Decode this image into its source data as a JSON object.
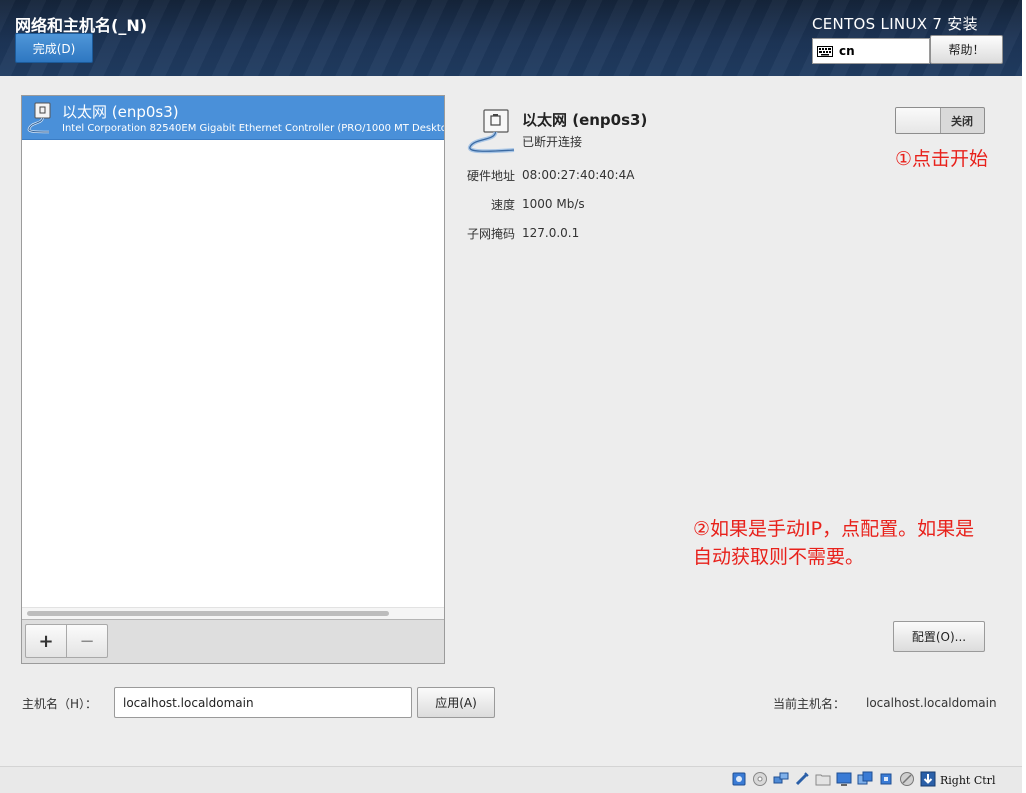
{
  "header": {
    "page_title": "网络和主机名(_N)",
    "done_label": "完成(D)",
    "product_title": "CENTOS LINUX 7 安装",
    "keyboard_layout": "cn",
    "help_label": "帮助！"
  },
  "network_list": {
    "items": [
      {
        "name": "以太网 (enp0s3)",
        "description": "Intel Corporation 82540EM Gigabit Ethernet Controller (PRO/1000 MT Deskto",
        "selected": true
      }
    ],
    "add_label": "+",
    "remove_label": "−"
  },
  "details": {
    "name": "以太网 (enp0s3)",
    "status": "已断开连接",
    "toggle_label": "关闭",
    "toggle_on": false,
    "properties": [
      {
        "label": "硬件地址",
        "value": "08:00:27:40:40:4A"
      },
      {
        "label": "速度",
        "value": "1000 Mb/s"
      },
      {
        "label": "子网掩码",
        "value": "127.0.0.1"
      }
    ],
    "configure_label": "配置(O)..."
  },
  "annotations": {
    "note1": "①点击开始",
    "note2_line1": "②如果是手动IP，点配置。如果是",
    "note2_line2": "自动获取则不需要。"
  },
  "hostname": {
    "label": "主机名（H）：",
    "value": "localhost.localdomain",
    "apply_label": "应用(A)",
    "current_label": "当前主机名：",
    "current_value": "localhost.localdomain"
  },
  "statusbar": {
    "icons": [
      "hard-disk-icon",
      "optical-drive-icon",
      "network-icon",
      "usb-icon",
      "shared-folder-icon",
      "display-icon",
      "video-capture-icon",
      "cpu-icon",
      "mouse-integration-icon",
      "arrow-down-icon"
    ],
    "host_key": "Right Ctrl"
  },
  "colors": {
    "selection": "#4a90d9",
    "annotation": "#e8211b",
    "header_bg": "#1d3557",
    "done_button": "#3a83cc"
  }
}
